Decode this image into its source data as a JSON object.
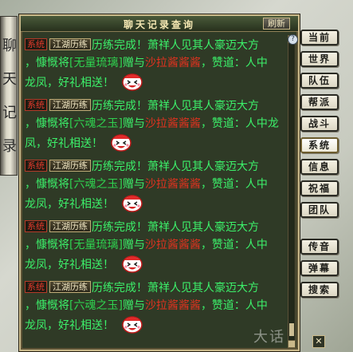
{
  "left_scroll": {
    "glyphs": [
      "聊",
      "天",
      "记",
      "录"
    ]
  },
  "window": {
    "title": "聊天记录查询",
    "refresh_label": "刷新",
    "close_label": "✕",
    "help_label": "?"
  },
  "messages": [
    {
      "sys_tag": "系统",
      "channel_tag": "江湖历练",
      "line1": {
        "pre": "历练完成！萧祥人见其人豪迈大方",
        "post": ""
      },
      "line2": {
        "pre": "，慷慨将",
        "item": "[无量琉璃]",
        "mid": "赠与",
        "player": "沙拉酱酱酱",
        "post": "，赞道：人中"
      },
      "line3": {
        "pre": "龙凤，好礼相送！"
      }
    },
    {
      "sys_tag": "系统",
      "channel_tag": "江湖历练",
      "line1": {
        "pre": "历练完成！萧祥人见其人豪迈大方"
      },
      "line2": {
        "pre": "，慷慨将",
        "item": "[六魂之玉]",
        "mid": "赠与",
        "player": "沙拉酱酱酱",
        "post": "，赞道：人中龙"
      },
      "line3": {
        "pre": "凤，好礼相送！"
      }
    },
    {
      "sys_tag": "系统",
      "channel_tag": "江湖历练",
      "line1": {
        "pre": "历练完成！萧祥人见其人豪迈大方"
      },
      "line2": {
        "pre": "，慷慨将",
        "item": "[六魂之玉]",
        "mid": "赠与",
        "player": "沙拉酱酱酱",
        "post": "，赞道：人中"
      },
      "line3": {
        "pre": "龙凤，好礼相送！"
      }
    },
    {
      "sys_tag": "系统",
      "channel_tag": "江湖历练",
      "line1": {
        "pre": "历练完成！萧祥人见其人豪迈大方"
      },
      "line2": {
        "pre": "，慷慨将",
        "item": "[无量琉璃]",
        "mid": "赠与",
        "player": "沙拉酱酱酱",
        "post": "，赞道：人中"
      },
      "line3": {
        "pre": "龙凤，好礼相送！"
      }
    },
    {
      "sys_tag": "系统",
      "channel_tag": "江湖历练",
      "line1": {
        "pre": "历练完成！萧祥人见其人豪迈大方"
      },
      "line2": {
        "pre": "，慷慨将",
        "item": "[六魂之玉]",
        "mid": "赠与",
        "player": "沙拉酱酱酱",
        "post": "，赞道：人中"
      },
      "line3": {
        "pre": "龙凤，好礼相送！"
      }
    }
  ],
  "tabs": [
    "当前",
    "世界",
    "队伍",
    "帮派",
    "战斗",
    "系统",
    "信息",
    "祝福",
    "团队",
    "传音",
    "弹幕",
    "搜索"
  ],
  "active_tab": "系统",
  "watermark": "大话",
  "colors": {
    "text_green": "#3cf06a",
    "player_red": "#e2321f",
    "sys_red": "#e23b2b",
    "panel_bg": "#2f3a26"
  },
  "icons": {
    "emote": "laughing-face-icon"
  }
}
